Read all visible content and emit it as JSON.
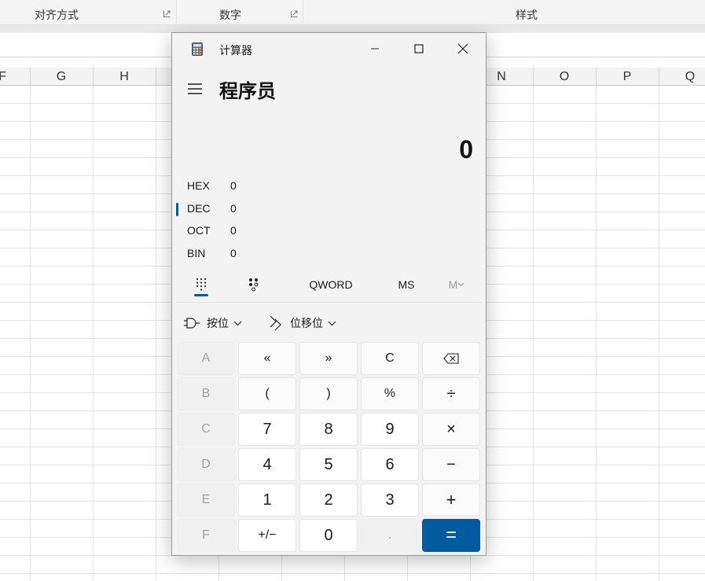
{
  "excel": {
    "ribbon_groups": [
      {
        "label": "对齐方式"
      },
      {
        "label": "数字"
      },
      {
        "label": "样式"
      }
    ],
    "columns": [
      "F",
      "G",
      "H",
      "N",
      "O",
      "P",
      "Q"
    ]
  },
  "calculator": {
    "window_title": "计算器",
    "mode": "程序员",
    "display_value": "0",
    "radix": [
      {
        "name": "HEX",
        "value": "0"
      },
      {
        "name": "DEC",
        "value": "0",
        "selected": true
      },
      {
        "name": "OCT",
        "value": "0"
      },
      {
        "name": "BIN",
        "value": "0"
      }
    ],
    "toolbar": {
      "keypad_icon": "keypad-grid-icon",
      "bitflip_icon": "bit-toggle-icon",
      "word_size": "QWORD",
      "memory_store": "MS",
      "memory_menu": "M"
    },
    "bitwise_label": "按位",
    "bitshift_label": "位移位",
    "keys": [
      [
        "A",
        "«",
        "»",
        "C",
        "backspace"
      ],
      [
        "B",
        "(",
        ")",
        "%",
        "÷"
      ],
      [
        "C",
        "7",
        "8",
        "9",
        "×"
      ],
      [
        "D",
        "4",
        "5",
        "6",
        "−"
      ],
      [
        "E",
        "1",
        "2",
        "3",
        "+"
      ],
      [
        "F",
        "+/−",
        "0",
        ".",
        "="
      ]
    ],
    "accent_color": "#005a9e"
  }
}
